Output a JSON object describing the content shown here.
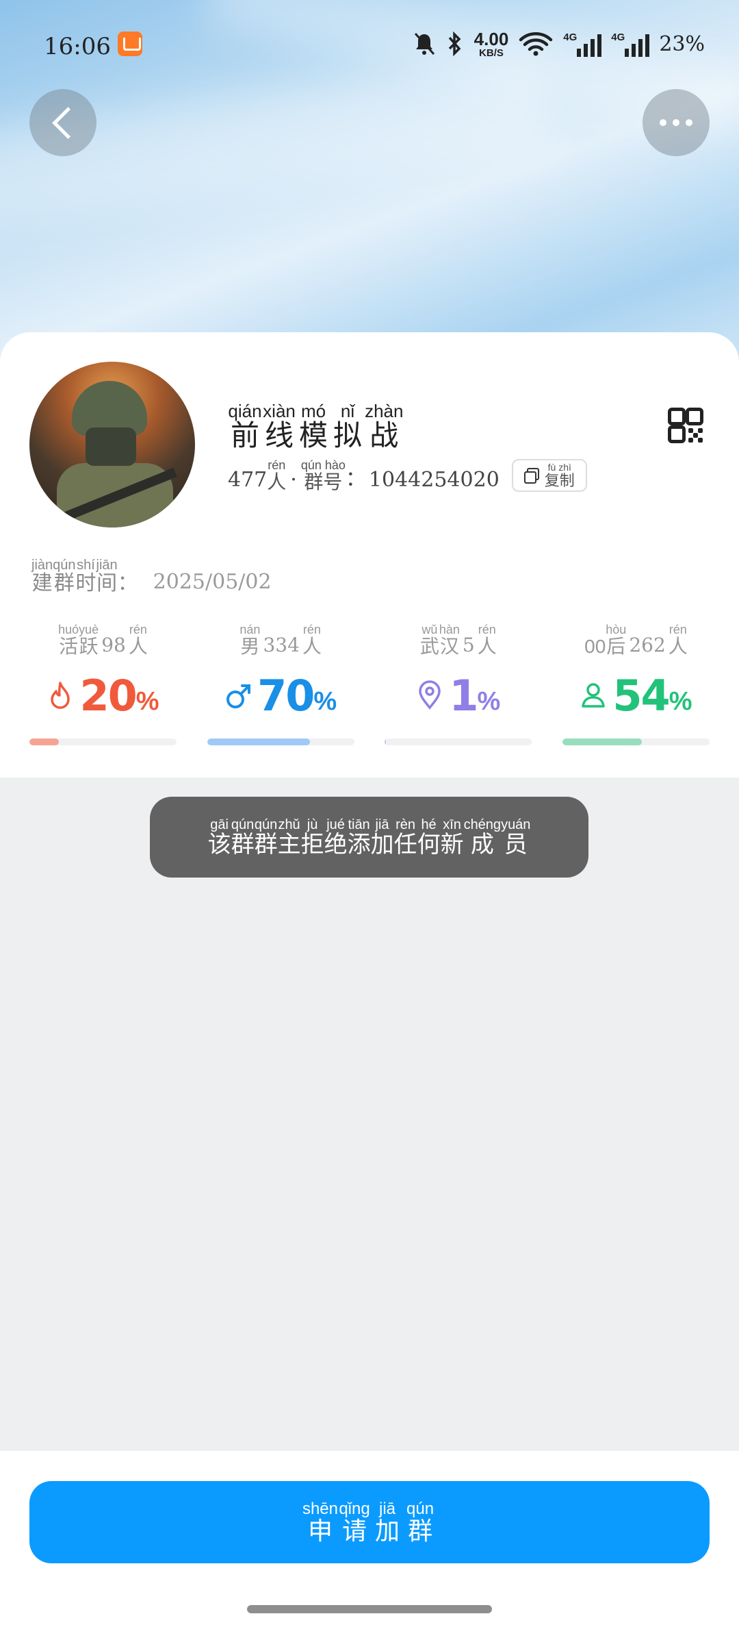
{
  "status_bar": {
    "time": "16:06",
    "net_speed": "4.00",
    "net_unit": "KB/S",
    "battery": "23%",
    "sim1": "4G",
    "sim2": "4G"
  },
  "group": {
    "name": [
      {
        "py": "qián",
        "hz": "前"
      },
      {
        "py": "xiàn",
        "hz": "线"
      },
      {
        "py": "mó",
        "hz": "模"
      },
      {
        "py": "nǐ",
        "hz": "拟"
      },
      {
        "py": "zhàn",
        "hz": "战"
      }
    ],
    "member_count": "477",
    "member_unit": {
      "py": "rén",
      "hz": "人"
    },
    "dot": "·",
    "group_no_label": {
      "py": "qún hào",
      "hz": "群号"
    },
    "colon": "：",
    "group_no": "1044254020",
    "copy_label": {
      "py": "fù zhì",
      "hz": "复制"
    }
  },
  "founded": {
    "label": [
      {
        "py": "jiàn",
        "hz": "建"
      },
      {
        "py": "qún",
        "hz": "群"
      },
      {
        "py": "shí",
        "hz": "时"
      },
      {
        "py": "jiān",
        "hz": "间"
      }
    ],
    "colon": "：",
    "date": "2025/05/02"
  },
  "stats": [
    {
      "prefix": [
        {
          "py": "huó",
          "hz": "活"
        },
        {
          "py": "yuè",
          "hz": "跃"
        }
      ],
      "num": "98",
      "suffix": {
        "py": "rén",
        "hz": "人"
      },
      "value": "20",
      "percent_sign": "%",
      "fill": 0.2,
      "color": "#f05a3c",
      "bar_color": "#f7a393",
      "icon": "flame-icon"
    },
    {
      "prefix": [
        {
          "py": "nán",
          "hz": "男"
        }
      ],
      "num": "334",
      "suffix": {
        "py": "rén",
        "hz": "人"
      },
      "value": "70",
      "percent_sign": "%",
      "fill": 0.7,
      "color": "#1a8fe6",
      "bar_color": "#9fcaf6",
      "icon": "male-icon"
    },
    {
      "prefix": [
        {
          "py": "wǔ",
          "hz": "武"
        },
        {
          "py": "hàn",
          "hz": "汉"
        }
      ],
      "num": "5",
      "suffix": {
        "py": "rén",
        "hz": "人"
      },
      "value": "1",
      "percent_sign": "%",
      "fill": 0.01,
      "color": "#8f7fe6",
      "bar_color": "#c7c2ea",
      "icon": "location-icon"
    },
    {
      "prefix": [
        {
          "py": "",
          "hz": "00"
        },
        {
          "py": "hòu",
          "hz": "后"
        }
      ],
      "num": "262",
      "suffix": {
        "py": "rén",
        "hz": "人"
      },
      "value": "54",
      "percent_sign": "%",
      "fill": 0.54,
      "color": "#22c27a",
      "bar_color": "#98ddbc",
      "icon": "person-icon"
    }
  ],
  "toast": [
    {
      "py": "gāi",
      "hz": "该"
    },
    {
      "py": "qún",
      "hz": "群"
    },
    {
      "py": "qún",
      "hz": "群"
    },
    {
      "py": "zhǔ",
      "hz": "主"
    },
    {
      "py": "jù",
      "hz": "拒"
    },
    {
      "py": "jué",
      "hz": "绝"
    },
    {
      "py": "tiān",
      "hz": "添"
    },
    {
      "py": "jiā",
      "hz": "加"
    },
    {
      "py": "rèn",
      "hz": "任"
    },
    {
      "py": "hé",
      "hz": "何"
    },
    {
      "py": "xīn",
      "hz": "新"
    },
    {
      "py": "chéng",
      "hz": "成"
    },
    {
      "py": "yuán",
      "hz": "员"
    }
  ],
  "join_button": [
    {
      "py": "shēn",
      "hz": "申"
    },
    {
      "py": "qǐng",
      "hz": "请"
    },
    {
      "py": "jiā",
      "hz": "加"
    },
    {
      "py": "qún",
      "hz": "群"
    }
  ]
}
